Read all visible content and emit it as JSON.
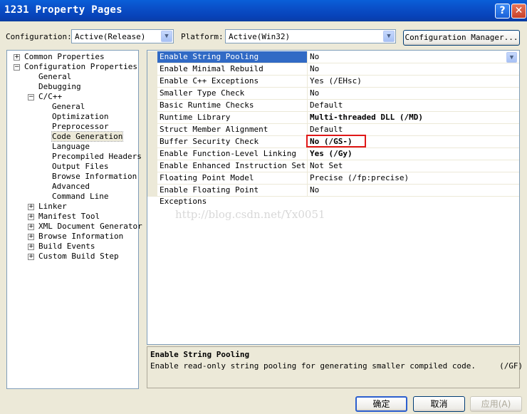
{
  "window": {
    "title": "1231 Property Pages",
    "help_glyph": "?",
    "close_glyph": "✕"
  },
  "config": {
    "configuration_label": "Configuration:",
    "configuration_value": "Active(Release)",
    "platform_label": "Platform:",
    "platform_value": "Active(Win32)",
    "manager_button": "Configuration Manager..."
  },
  "tree": {
    "items": [
      {
        "label": "Common Properties",
        "expander": "+"
      },
      {
        "label": "Configuration Properties",
        "expander": "−"
      },
      {
        "label": "General"
      },
      {
        "label": "Debugging"
      },
      {
        "label": "C/C++",
        "expander": "−"
      },
      {
        "label": "General"
      },
      {
        "label": "Optimization"
      },
      {
        "label": "Preprocessor"
      },
      {
        "label": "Code Generation"
      },
      {
        "label": "Language"
      },
      {
        "label": "Precompiled Headers"
      },
      {
        "label": "Output Files"
      },
      {
        "label": "Browse Information"
      },
      {
        "label": "Advanced"
      },
      {
        "label": "Command Line"
      },
      {
        "label": "Linker",
        "expander": "+"
      },
      {
        "label": "Manifest Tool",
        "expander": "+"
      },
      {
        "label": "XML Document Generator",
        "expander": "+"
      },
      {
        "label": "Browse Information",
        "expander": "+"
      },
      {
        "label": "Build Events",
        "expander": "+"
      },
      {
        "label": "Custom Build Step",
        "expander": "+"
      }
    ]
  },
  "properties": [
    {
      "name": "Enable String Pooling",
      "value": "No"
    },
    {
      "name": "Enable Minimal Rebuild",
      "value": "No"
    },
    {
      "name": "Enable C++ Exceptions",
      "value": "Yes (/EHsc)"
    },
    {
      "name": "Smaller Type Check",
      "value": "No"
    },
    {
      "name": "Basic Runtime Checks",
      "value": "Default"
    },
    {
      "name": "Runtime Library",
      "value": "Multi-threaded DLL (/MD)"
    },
    {
      "name": "Struct Member Alignment",
      "value": "Default"
    },
    {
      "name": "Buffer Security Check",
      "value": "No (/GS-)"
    },
    {
      "name": "Enable Function-Level Linking",
      "value": "Yes (/Gy)"
    },
    {
      "name": "Enable Enhanced Instruction Set",
      "value": "Not Set"
    },
    {
      "name": "Floating Point Model",
      "value": "Precise (/fp:precise)"
    },
    {
      "name": "Enable Floating Point Exceptions",
      "value": "No"
    }
  ],
  "watermark": "http://blog.csdn.net/Yx0051",
  "description": {
    "title": "Enable String Pooling",
    "text": "Enable read-only string pooling for generating smaller compiled code.     (/GF)"
  },
  "buttons": {
    "ok": "确定",
    "cancel": "取消",
    "apply": "应用(A)"
  },
  "colors": {
    "selection": "#316ac5",
    "highlight_box": "#e01818",
    "titlebar": "#0a4fc8"
  }
}
